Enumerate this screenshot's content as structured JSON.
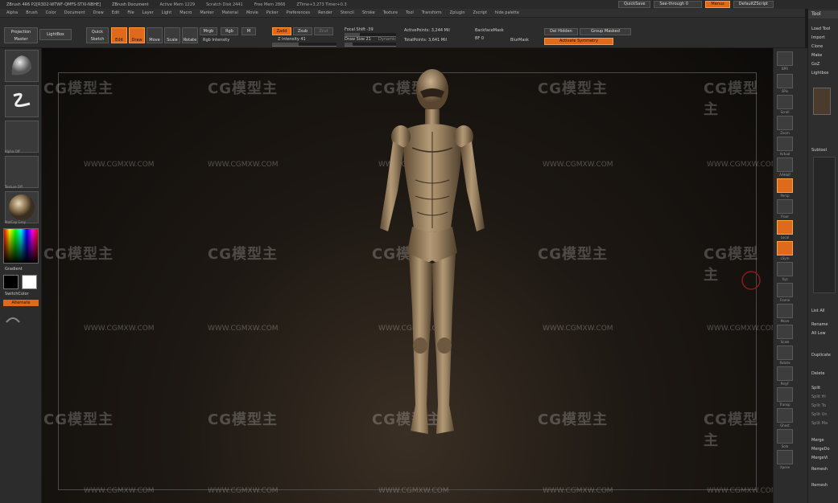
{
  "titlebar": {
    "app": "ZBrush 4R6  P2[R3D2-WTWF-QMFS-STXI-NBHE]",
    "document": "ZBrush Document",
    "active_mem": "Active Mem 1229",
    "scratch": "Scratch Disk 2441",
    "free_mem": "Free Mem 2866",
    "ztime": "ZTime+3.273 Timer+0.3",
    "quicksave": "QuickSave",
    "seethrough": "See-through  0",
    "menus": "Menus",
    "defaultzscript": "DefaultZScript"
  },
  "menubar": {
    "items": [
      "Alpha",
      "Brush",
      "Color",
      "Document",
      "Draw",
      "Edit",
      "File",
      "Layer",
      "Light",
      "Macro",
      "Marker",
      "Material",
      "Movie",
      "Picker",
      "Preferences",
      "Render",
      "Stencil",
      "Stroke",
      "Texture",
      "Tool",
      "Transform",
      "Zplugin",
      "Zscript",
      "hide palette"
    ]
  },
  "toolbar": {
    "projection_master": "Projection Master",
    "lightbox": "LightBox",
    "quick_sketch": "Quick Sketch",
    "edit": "Edit",
    "draw": "Draw",
    "move": "Move",
    "scale": "Scale",
    "rotate": "Rotate",
    "mrgb": "Mrgb",
    "rgb": "Rgb",
    "m": "M",
    "rgb_intensity": "Rgb Intensity",
    "zadd": "Zadd",
    "zsub": "Zsub",
    "zcut": "Zcut",
    "z_intensity": "Z Intensity 41",
    "focal_shift": "Focal Shift -39",
    "draw_size": "Draw Size 21",
    "dynamic": "Dynamic",
    "active_points": "ActivePoints: 3,244 Mil",
    "total_points": "TotalPoints: 3,641 Mil",
    "backface_mask": "BackfaceMask",
    "bf": "BF 0",
    "blur_mask": "BlurMask",
    "del_hidden": "Del Hidden",
    "group_masked": "Group Masked",
    "activate_symmetry": "Activate Symmetry"
  },
  "left": {
    "gradient": "Gradient",
    "switch_color": "SwitchColor",
    "alternate": "Alternate",
    "bpr": "BPR",
    "slots": [
      "",
      "",
      "Alpha Off",
      "Texture Off",
      "MatCap Gray"
    ]
  },
  "right": {
    "buttons": [
      "BPR",
      "SPix",
      "Scroll",
      "Zoom",
      "Actual",
      "AAHalf",
      "Persp",
      "Floor",
      "Local",
      "LSym",
      "Xyz",
      "Frame",
      "Move",
      "Scale",
      "Rotate",
      "PolyF",
      "Transp",
      "Ghost",
      "Solo",
      "Xpose"
    ]
  },
  "tool_panel": {
    "title": "Tool",
    "items": [
      "Load Tool",
      "Import",
      "Clone",
      "Make",
      "GoZ",
      "Lightbox",
      "Subtool",
      "List All",
      "Rename",
      "All Low",
      "Duplicate",
      "Delete",
      "Split",
      "Split Hi",
      "Split To",
      "Split Un",
      "Split Ma",
      "Merge",
      "MergeDo",
      "MergeVi",
      "Remesh",
      "Remesh"
    ]
  },
  "watermark": {
    "logo": "CG模型主",
    "url": "WWW.CGMXW.COM"
  }
}
